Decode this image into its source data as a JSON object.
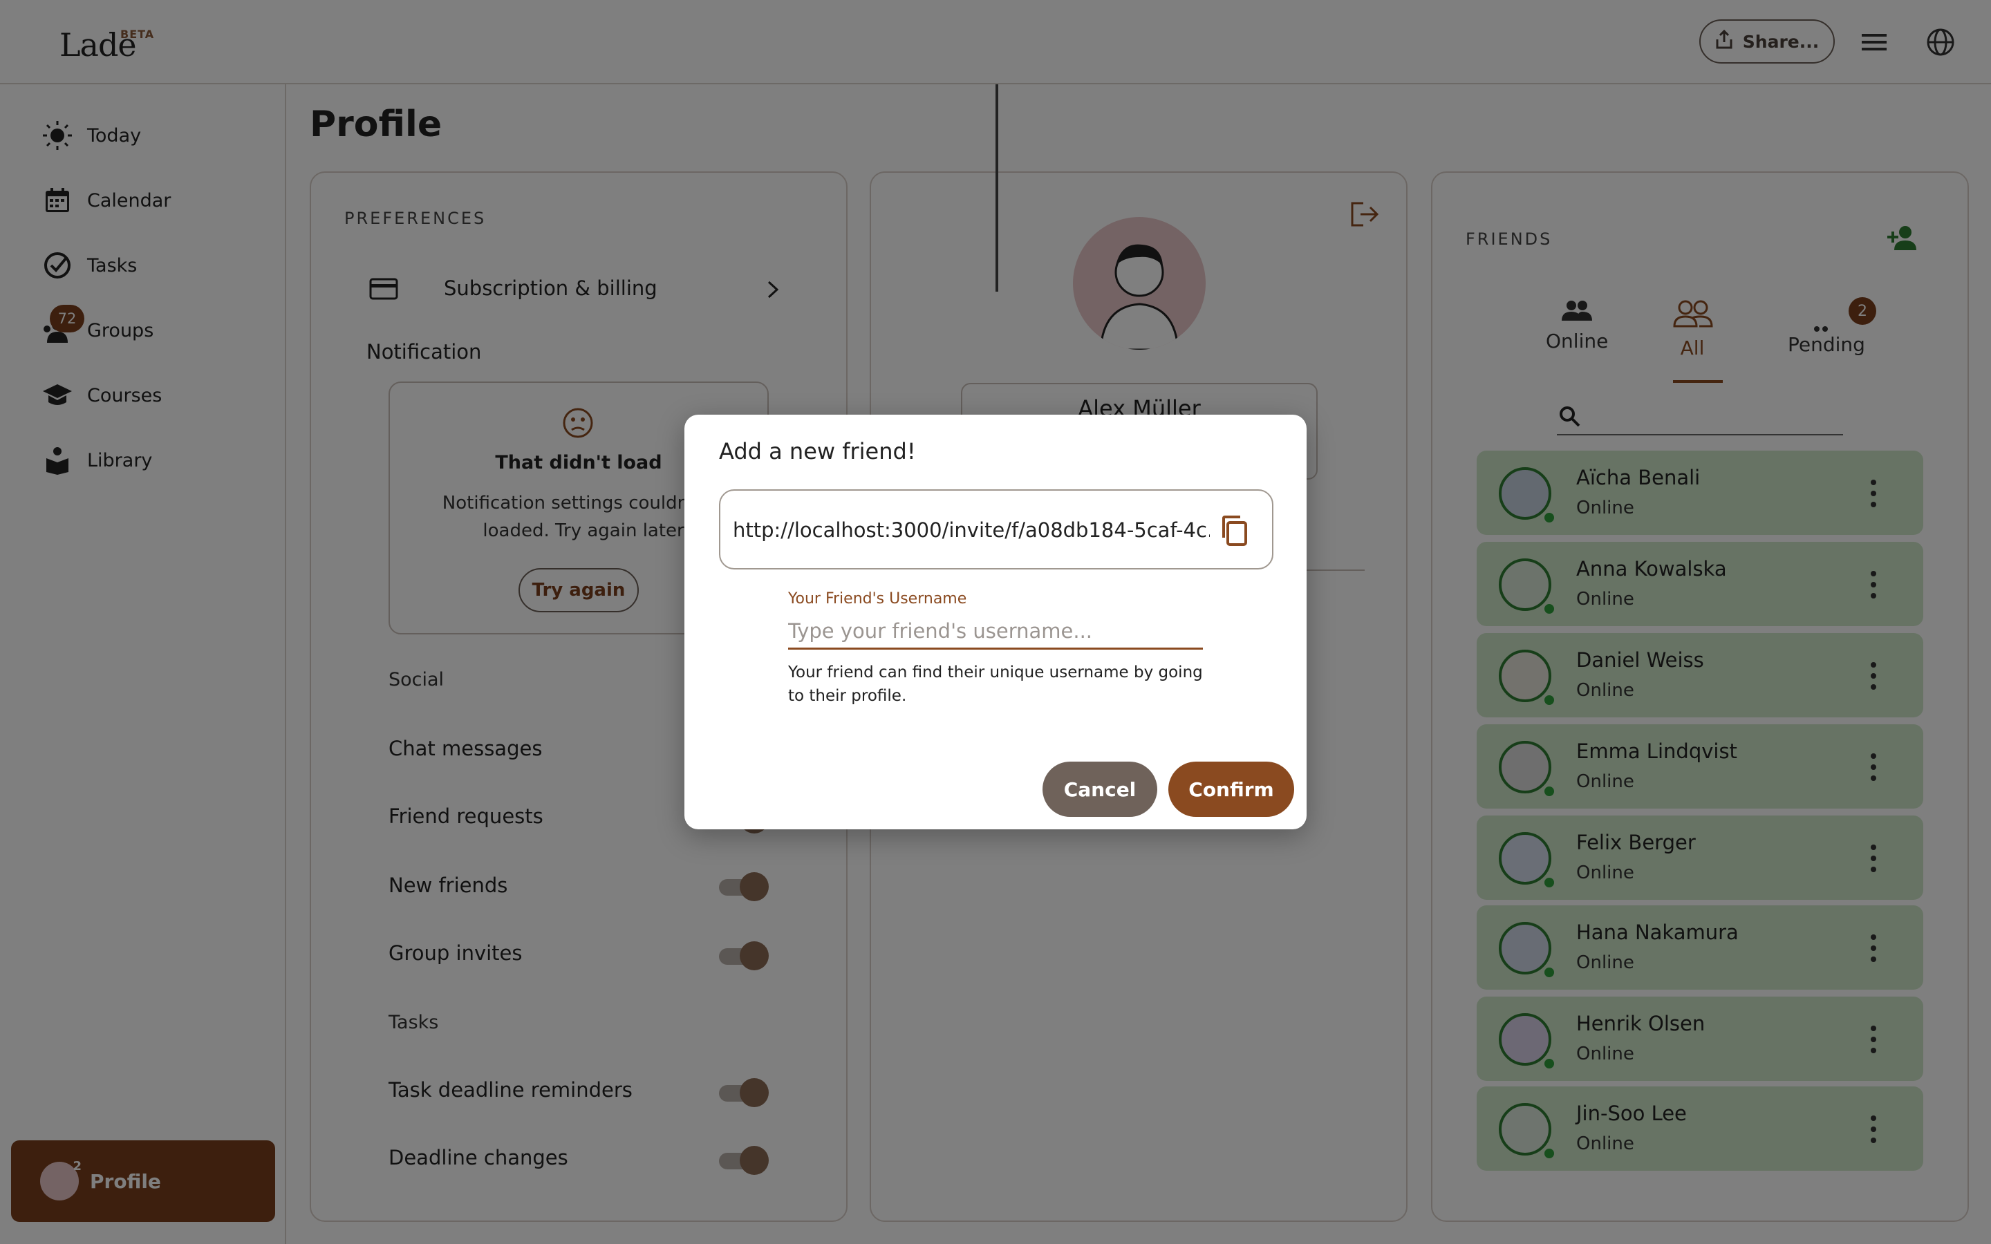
{
  "header": {
    "logo_text": "Lade",
    "beta": "BETA",
    "share_label": "Share...",
    "icons": [
      "upload-icon",
      "menu-icon",
      "globe-icon"
    ]
  },
  "sidebar": {
    "items": [
      {
        "label": "Today",
        "icon": "sun-icon"
      },
      {
        "label": "Calendar",
        "icon": "calendar-icon"
      },
      {
        "label": "Tasks",
        "icon": "check-circle-icon"
      },
      {
        "label": "Groups",
        "icon": "groups-icon",
        "badge": "72"
      },
      {
        "label": "Courses",
        "icon": "graduation-cap-icon"
      },
      {
        "label": "Library",
        "icon": "book-reader-icon"
      }
    ],
    "profile": {
      "label": "Profile",
      "badge": "2"
    }
  },
  "page": {
    "title": "Profile"
  },
  "preferences": {
    "heading": "PREFERENCES",
    "subscription": "Subscription & billing",
    "notification": "Notification",
    "error_title": "That didn't load",
    "error_text": "Notification settings couldn't be loaded. Try again later.",
    "retry": "Try again",
    "social": "Social",
    "chat": "Chat messages",
    "friend_requests": "Friend requests",
    "new_friends": "New friends",
    "group_invites": "Group invites",
    "tasks": "Tasks",
    "task_deadline": "Task deadline reminders",
    "deadline_changes": "Deadline changes"
  },
  "profile_card": {
    "name": "Alex Müller"
  },
  "friends": {
    "heading": "FRIENDS",
    "tabs": [
      {
        "label": "Online"
      },
      {
        "label": "All",
        "active": true
      },
      {
        "label": "Pending",
        "badge": "2"
      }
    ],
    "list": [
      {
        "name": "Aïcha Benali",
        "status": "Online"
      },
      {
        "name": "Anna Kowalska",
        "status": "Online"
      },
      {
        "name": "Daniel Weiss",
        "status": "Online"
      },
      {
        "name": "Emma Lindqvist",
        "status": "Online"
      },
      {
        "name": "Felix Berger",
        "status": "Online"
      },
      {
        "name": "Hana Nakamura",
        "status": "Online"
      },
      {
        "name": "Henrik Olsen",
        "status": "Online"
      },
      {
        "name": "Jin-Soo Lee",
        "status": "Online"
      }
    ]
  },
  "modal": {
    "title": "Add a new friend!",
    "invite_link": "http://localhost:3000/invite/f/a08db184-5caf-4c...",
    "field_label": "Your Friend's Username",
    "placeholder": "Type your friend's username...",
    "helper": "Your friend can find their unique username by going to their profile.",
    "cancel": "Cancel",
    "confirm": "Confirm"
  },
  "colors": {
    "brand": "#7a3e1c",
    "accent": "#8a4a20",
    "friend_bg": "#cfe6c9",
    "online": "#2e9e3a"
  }
}
